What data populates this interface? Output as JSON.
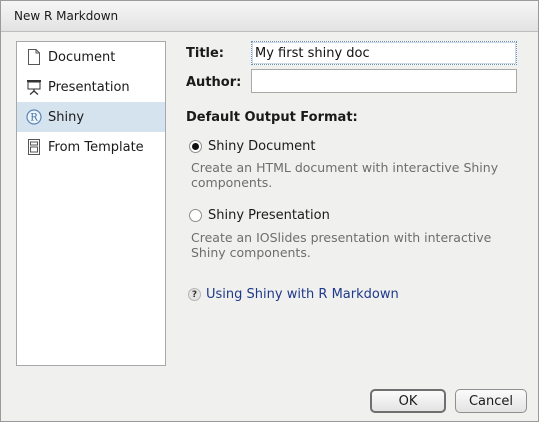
{
  "window": {
    "title": "New R Markdown"
  },
  "sidebar": {
    "items": [
      {
        "label": "Document",
        "icon": "document-icon",
        "selected": false
      },
      {
        "label": "Presentation",
        "icon": "presentation-icon",
        "selected": false
      },
      {
        "label": "Shiny",
        "icon": "shiny-r-icon",
        "selected": true
      },
      {
        "label": "From Template",
        "icon": "template-icon",
        "selected": false
      }
    ]
  },
  "form": {
    "title_label": "Title:",
    "title_value": "My first shiny doc",
    "author_label": "Author:",
    "author_value": ""
  },
  "output_format": {
    "heading": "Default Output Format:",
    "options": [
      {
        "label": "Shiny Document",
        "selected": true,
        "description": "Create an HTML document with interactive Shiny components."
      },
      {
        "label": "Shiny Presentation",
        "selected": false,
        "description": "Create an IOSlides presentation with interactive Shiny components."
      }
    ]
  },
  "help": {
    "icon": "help-icon",
    "icon_glyph": "?",
    "link_text": "Using Shiny with R Markdown"
  },
  "buttons": {
    "ok": "OK",
    "cancel": "Cancel"
  }
}
